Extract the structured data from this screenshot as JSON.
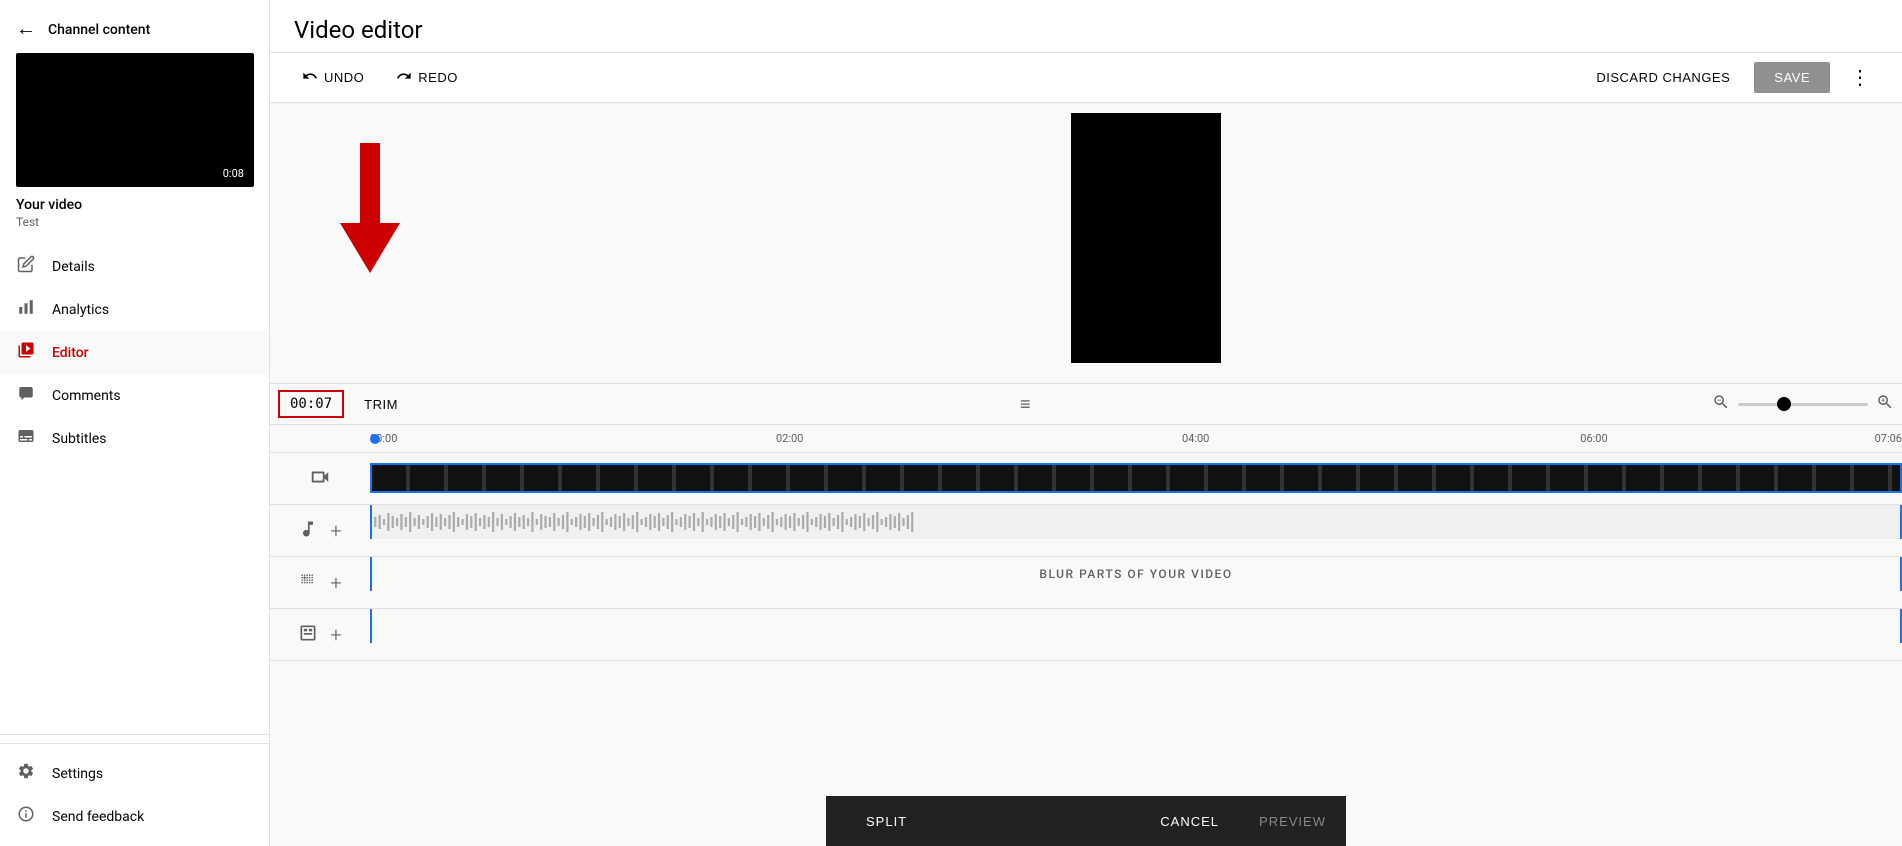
{
  "sidebar": {
    "back_label": "←",
    "channel_content_label": "Channel content",
    "video": {
      "duration": "0:08",
      "title": "Your video",
      "subtitle": "Test"
    },
    "nav_items": [
      {
        "id": "details",
        "label": "Details",
        "icon": "✏"
      },
      {
        "id": "analytics",
        "label": "Analytics",
        "icon": "▦"
      },
      {
        "id": "editor",
        "label": "Editor",
        "icon": "🎬",
        "active": true
      },
      {
        "id": "comments",
        "label": "Comments",
        "icon": "💬"
      },
      {
        "id": "subtitles",
        "label": "Subtitles",
        "icon": "⬛"
      }
    ],
    "bottom_items": [
      {
        "id": "settings",
        "label": "Settings",
        "icon": "⚙"
      },
      {
        "id": "send-feedback",
        "label": "Send feedback",
        "icon": "ℹ"
      }
    ]
  },
  "header": {
    "title": "Video editor"
  },
  "toolbar": {
    "undo_label": "UNDO",
    "redo_label": "REDO",
    "discard_label": "DISCARD CHANGES",
    "save_label": "SAVE"
  },
  "timeline": {
    "timecode": "00:07",
    "trim_label": "TRIM",
    "ruler_marks": [
      "00:00",
      "02:00",
      "04:00",
      "06:00",
      "07:06"
    ],
    "blur_label": "BLUR PARTS OF YOUR VIDEO"
  },
  "split_controls": {
    "split_label": "SPLIT",
    "cancel_label": "CANCEL",
    "preview_label": "PREVIEW"
  }
}
